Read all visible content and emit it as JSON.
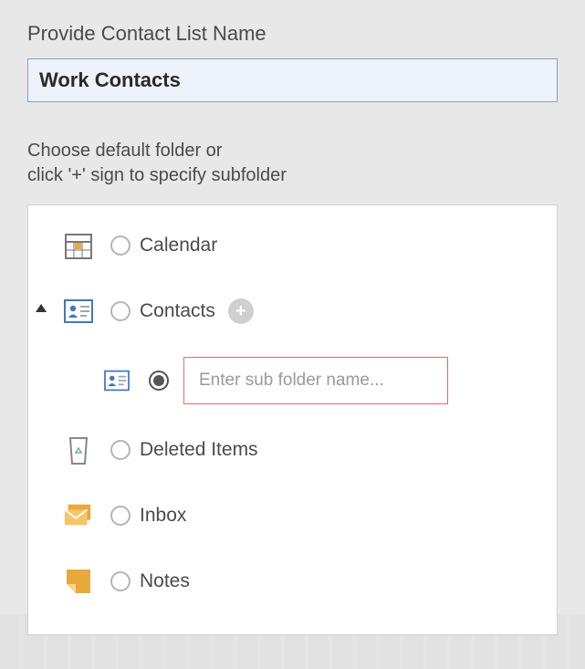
{
  "heading": "Provide Contact List Name",
  "contact_list_name": "Work Contacts",
  "instruction_line1": "Choose default folder or",
  "instruction_line2": "click '+' sign to specify subfolder",
  "subfolder_placeholder": "Enter sub folder name...",
  "subfolder_value": "",
  "folders": {
    "calendar": {
      "label": "Calendar",
      "selected": false,
      "expandable": false
    },
    "contacts": {
      "label": "Contacts",
      "selected": false,
      "expandable": true,
      "expanded": true
    },
    "deleted": {
      "label": "Deleted Items",
      "selected": false,
      "expandable": false
    },
    "inbox": {
      "label": "Inbox",
      "selected": false,
      "expandable": false
    },
    "notes": {
      "label": "Notes",
      "selected": false,
      "expandable": false
    }
  },
  "subfolder_selected": true,
  "colors": {
    "accent_orange": "#e7a93c",
    "panel_bg": "#ffffff",
    "page_bg": "#e8e8e8",
    "input_bg": "#eef3fb",
    "input_border": "#8aa0c0",
    "error_border": "#d9706d"
  }
}
